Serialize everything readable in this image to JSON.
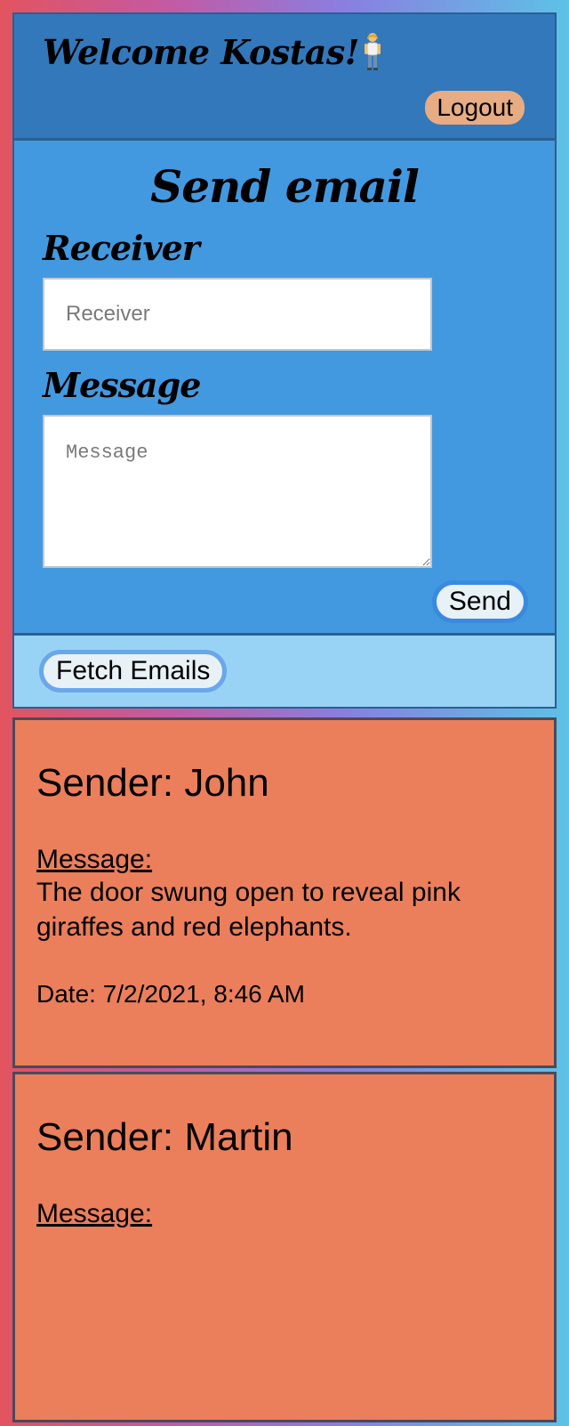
{
  "header": {
    "welcome": "Welcome Kostas!",
    "logout_label": "Logout"
  },
  "compose": {
    "title": "Send email",
    "receiver_label": "Receiver",
    "receiver_placeholder": "Receiver",
    "message_label": "Message",
    "message_placeholder": "Message",
    "send_label": "Send"
  },
  "fetch": {
    "label": "Fetch Emails"
  },
  "emails": [
    {
      "sender": "Sender: John",
      "message_label": "Message:",
      "message": "The door swung open to reveal pink giraffes and red elephants.",
      "date": "Date: 7/2/2021, 8:46 AM"
    },
    {
      "sender": "Sender: Martin",
      "message_label": "Message:"
    }
  ],
  "icons": {
    "welcome_icon": "person-standing-icon"
  },
  "colors": {
    "header_bg": "#3378bb",
    "compose_bg": "#4399df",
    "fetch_bg": "#98d3f5",
    "card_bg": "#eb7f5b",
    "logout_bg": "#e7ac83"
  }
}
